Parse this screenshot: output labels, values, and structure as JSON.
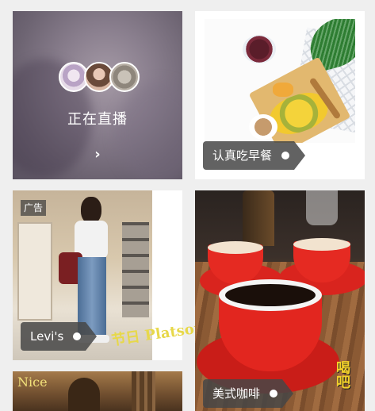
{
  "live_card": {
    "label": "正在直播",
    "chevron": "›",
    "avatar_count": 3
  },
  "feed": [
    {
      "id": "breakfast",
      "tag": "认真吃早餐",
      "is_ad": false
    },
    {
      "id": "levis",
      "tag": "Levi's",
      "is_ad": true,
      "ad_label": "广告",
      "overlay_text": "节日 Platsone"
    },
    {
      "id": "coffee",
      "tag": "美式咖啡",
      "is_ad": false,
      "overlay_text": "喝吧"
    },
    {
      "id": "church",
      "overlay_text": "Nice"
    }
  ],
  "colors": {
    "page_bg": "#efefef",
    "tag_bg": "#464646",
    "tag_text": "#ffffff"
  }
}
